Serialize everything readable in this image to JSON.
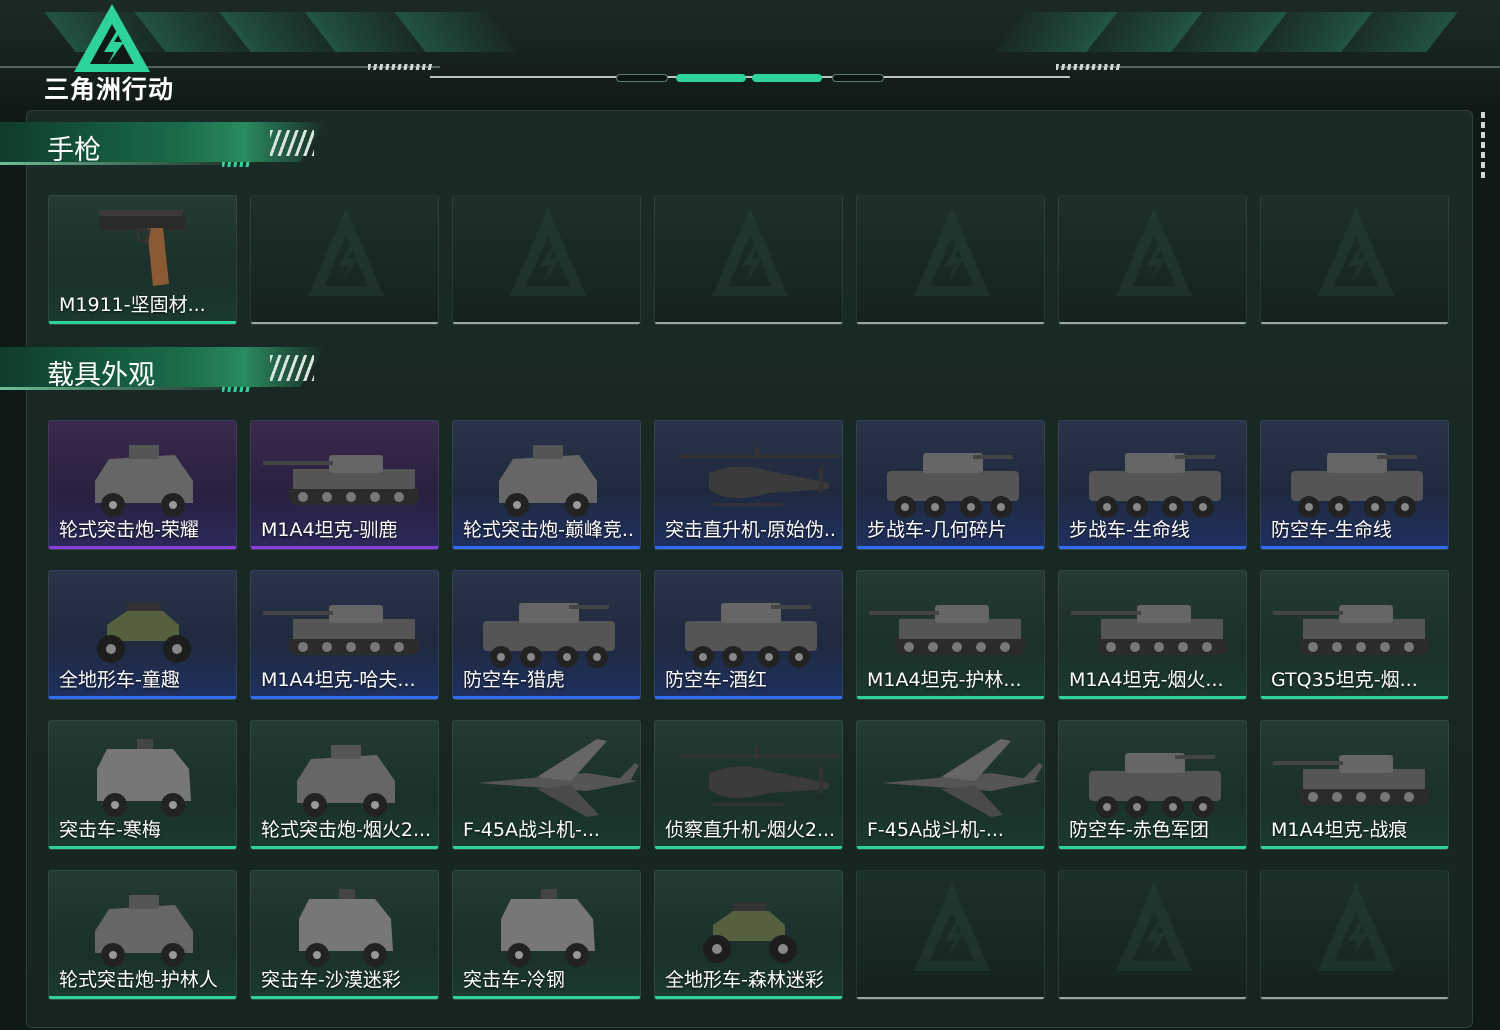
{
  "app": {
    "logo_text": "三角洲行动",
    "colors": {
      "accent": "#2ed39a",
      "rarity_green": "#2ed39a",
      "rarity_blue": "#2f6ef0",
      "rarity_purple": "#8a3ee0",
      "panel_bg": "#1a2a24"
    }
  },
  "sections": [
    {
      "title": "手枪",
      "items": [
        {
          "label": "M1911-坚固材...",
          "rarity": "green",
          "icon": "pistol-icon"
        },
        {
          "label": "",
          "rarity": "empty"
        },
        {
          "label": "",
          "rarity": "empty"
        },
        {
          "label": "",
          "rarity": "empty"
        },
        {
          "label": "",
          "rarity": "empty"
        },
        {
          "label": "",
          "rarity": "empty"
        },
        {
          "label": "",
          "rarity": "empty"
        }
      ]
    },
    {
      "title": "载具外观",
      "items": [
        {
          "label": "轮式突击炮-荣耀",
          "rarity": "purple",
          "icon": "armored-car-icon"
        },
        {
          "label": "M1A4坦克-驯鹿",
          "rarity": "purple",
          "icon": "tank-icon"
        },
        {
          "label": "轮式突击炮-巅峰竞...",
          "rarity": "blue",
          "icon": "armored-car-icon"
        },
        {
          "label": "突击直升机-原始伪...",
          "rarity": "blue",
          "icon": "helicopter-icon"
        },
        {
          "label": "步战车-几何碎片",
          "rarity": "blue",
          "icon": "ifv-icon"
        },
        {
          "label": "步战车-生命线",
          "rarity": "blue",
          "icon": "ifv-icon"
        },
        {
          "label": "防空车-生命线",
          "rarity": "blue",
          "icon": "ifv-icon"
        },
        {
          "label": "全地形车-童趣",
          "rarity": "blue",
          "icon": "atv-icon"
        },
        {
          "label": "M1A4坦克-哈夫...",
          "rarity": "blue",
          "icon": "tank-icon"
        },
        {
          "label": "防空车-猎虎",
          "rarity": "blue",
          "icon": "ifv-icon"
        },
        {
          "label": "防空车-酒红",
          "rarity": "blue",
          "icon": "ifv-icon"
        },
        {
          "label": "M1A4坦克-护林...",
          "rarity": "green",
          "icon": "tank-icon"
        },
        {
          "label": "M1A4坦克-烟火...",
          "rarity": "green",
          "icon": "tank-icon"
        },
        {
          "label": "GTQ35坦克-烟...",
          "rarity": "green",
          "icon": "tank-icon"
        },
        {
          "label": "突击车-寒梅",
          "rarity": "green",
          "icon": "assault-car-icon"
        },
        {
          "label": "轮式突击炮-烟火2...",
          "rarity": "green",
          "icon": "armored-car-icon"
        },
        {
          "label": "F-45A战斗机-...",
          "rarity": "green",
          "icon": "jet-icon"
        },
        {
          "label": "侦察直升机-烟火2...",
          "rarity": "green",
          "icon": "helicopter-icon"
        },
        {
          "label": "F-45A战斗机-...",
          "rarity": "green",
          "icon": "jet-icon"
        },
        {
          "label": "防空车-赤色军团",
          "rarity": "green",
          "icon": "ifv-icon"
        },
        {
          "label": "M1A4坦克-战痕",
          "rarity": "green",
          "icon": "tank-icon"
        },
        {
          "label": "轮式突击炮-护林人",
          "rarity": "green",
          "icon": "armored-car-icon"
        },
        {
          "label": "突击车-沙漠迷彩",
          "rarity": "green",
          "icon": "assault-car-icon"
        },
        {
          "label": "突击车-冷钢",
          "rarity": "green",
          "icon": "assault-car-icon"
        },
        {
          "label": "全地形车-森林迷彩",
          "rarity": "green",
          "icon": "atv-icon"
        },
        {
          "label": "",
          "rarity": "empty"
        },
        {
          "label": "",
          "rarity": "empty"
        },
        {
          "label": "",
          "rarity": "empty"
        }
      ]
    }
  ]
}
